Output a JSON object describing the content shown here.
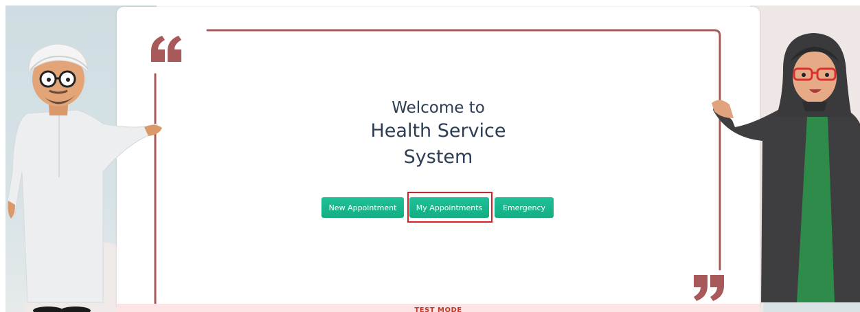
{
  "welcome": {
    "line1": "Welcome to",
    "line2": "Health Service",
    "line3": "System"
  },
  "buttons": {
    "new_appointment": "New Appointment",
    "my_appointments": "My Appointments",
    "emergency": "Emergency"
  },
  "banner": {
    "text": "TEST MODE"
  },
  "colors": {
    "frame": "#a85a5a",
    "button": "#17b48a",
    "title": "#2c3e55",
    "highlight": "#d92027"
  },
  "icons": {
    "open_quote": "open-quote-icon",
    "close_quote": "close-quote-icon"
  }
}
